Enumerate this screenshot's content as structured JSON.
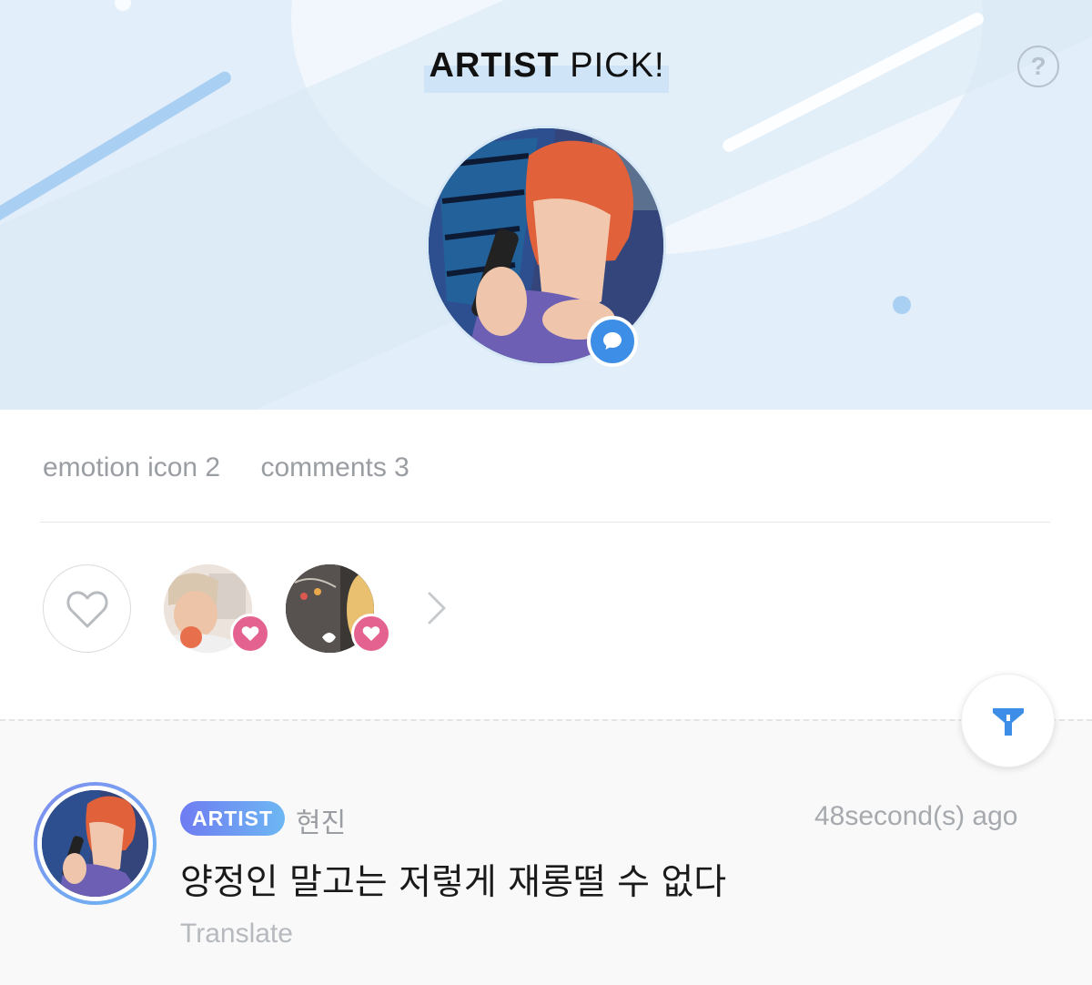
{
  "header": {
    "title_bold": "ARTIST",
    "title_rest": " PICK!",
    "help_glyph": "?",
    "accent_color": "#3c8ee6"
  },
  "stats": {
    "emotion_label": "emotion icon 2",
    "comments_label": "comments 3"
  },
  "reactions": {
    "like_icon": "heart-outline-icon",
    "badge_color": "#e3628f",
    "users": [
      {
        "avatar": "reaction-user-1"
      },
      {
        "avatar": "reaction-user-2"
      }
    ],
    "more_icon": "chevron-right-icon"
  },
  "comment": {
    "badge": "ARTIST",
    "author": "현진",
    "time": "48second(s) ago",
    "text": "양정인 말고는 저렇게 재롱떨 수 없다",
    "translate": "Translate"
  },
  "filter": {
    "icon": "filter-icon"
  }
}
